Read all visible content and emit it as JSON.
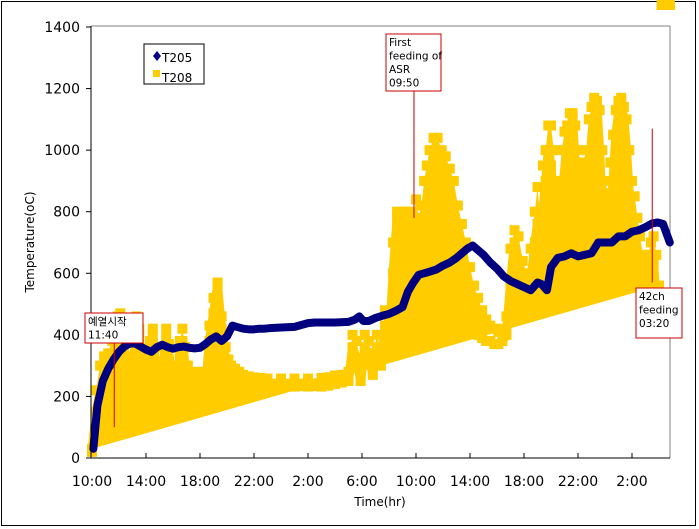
{
  "chart_data": {
    "type": "scatter",
    "title": "",
    "xlabel": "Time(hr)",
    "ylabel": "Temperature(oC)",
    "ylim": [
      0,
      1400
    ],
    "yticks": [
      0,
      200,
      400,
      600,
      800,
      1000,
      1200,
      1400
    ],
    "xlim_hours_from_start": [
      0,
      42.9
    ],
    "xticks": [
      {
        "h": 0,
        "label": "10:00"
      },
      {
        "h": 4,
        "label": "14:00"
      },
      {
        "h": 8,
        "label": "18:00"
      },
      {
        "h": 12,
        "label": "22:00"
      },
      {
        "h": 16,
        "label": "2:00"
      },
      {
        "h": 20,
        "label": "6:00"
      },
      {
        "h": 24,
        "label": "10:00"
      },
      {
        "h": 28,
        "label": "14:00"
      },
      {
        "h": 32,
        "label": "18:00"
      },
      {
        "h": 36,
        "label": "22:00"
      },
      {
        "h": 40,
        "label": "2:00"
      }
    ],
    "grid": false,
    "legend": {
      "position": "top-left",
      "entries": [
        {
          "name": "T205",
          "marker": "diamond",
          "color": "#00007F"
        },
        {
          "name": "T208",
          "marker": "square",
          "color": "#FFCC00"
        }
      ]
    },
    "series": [
      {
        "name": "T205",
        "color": "#00007F",
        "x_hours": [
          0.1,
          0.4,
          0.8,
          1.2,
          1.6,
          2.0,
          2.4,
          2.8,
          3.2,
          3.6,
          4.0,
          4.4,
          4.8,
          5.2,
          5.6,
          6.0,
          6.4,
          6.8,
          7.2,
          7.6,
          8.0,
          8.4,
          8.8,
          9.2,
          9.6,
          10.0,
          10.4,
          10.8,
          11.2,
          11.6,
          12.0,
          12.4,
          12.8,
          13.2,
          14.0,
          15.0,
          16.0,
          16.5,
          17.0,
          18.0,
          19.0,
          19.5,
          19.8,
          20.1,
          20.5,
          21.0,
          21.5,
          22.0,
          22.5,
          23.0,
          23.4,
          23.8,
          24.2,
          24.6,
          25.0,
          25.5,
          26.0,
          26.5,
          27.0,
          27.4,
          27.8,
          28.2,
          28.6,
          29.0,
          29.5,
          30.0,
          30.5,
          31.0,
          31.5,
          32.0,
          32.5,
          33.0,
          33.3,
          33.7,
          34.0,
          34.5,
          35.0,
          35.5,
          36.0,
          36.5,
          37.0,
          37.5,
          38.0,
          38.5,
          39.0,
          39.5,
          40.0,
          40.5,
          41.0,
          41.5,
          41.9,
          42.3,
          42.8
        ],
        "values": [
          30,
          170,
          250,
          290,
          320,
          345,
          362,
          372,
          372,
          362,
          352,
          345,
          360,
          368,
          360,
          355,
          360,
          362,
          358,
          356,
          358,
          370,
          385,
          395,
          380,
          395,
          430,
          425,
          420,
          418,
          418,
          420,
          420,
          422,
          424,
          426,
          438,
          440,
          440,
          440,
          442,
          450,
          460,
          445,
          445,
          455,
          462,
          468,
          478,
          490,
          540,
          570,
          595,
          600,
          605,
          612,
          625,
          635,
          650,
          665,
          680,
          690,
          675,
          660,
          635,
          615,
          590,
          575,
          565,
          555,
          545,
          570,
          565,
          545,
          620,
          650,
          655,
          665,
          655,
          660,
          665,
          700,
          700,
          700,
          720,
          720,
          735,
          740,
          750,
          762,
          765,
          760,
          700
        ]
      },
      {
        "name": "T208",
        "color": "#FFCC00",
        "x_hours": [
          0,
          0.3,
          0.6,
          0.9,
          1.2,
          1.5,
          1.7,
          1.9,
          2.1,
          2.3,
          2.5,
          2.7,
          2.9,
          3.1,
          3.3,
          3.5,
          3.7,
          3.9,
          4.1,
          4.3,
          4.5,
          4.7,
          4.9,
          5.1,
          5.3,
          5.5,
          5.7,
          5.9,
          6.1,
          6.3,
          6.5,
          6.7,
          6.9,
          7.1,
          7.3,
          7.5,
          7.8,
          8.1,
          8.4,
          8.7,
          9.0,
          9.3,
          9.6,
          9.9,
          10.1,
          10.3,
          10.6,
          10.9,
          11.2,
          11.6,
          12.0,
          12.5,
          13.0,
          14.0,
          15.0,
          16.0,
          17.0,
          17.5,
          18.0,
          18.5,
          19.0,
          19.3,
          19.6,
          19.9,
          20.2,
          20.5,
          20.8,
          21.1,
          21.4,
          21.7,
          22.0,
          22.3,
          22.6,
          22.9,
          23.2,
          23.5,
          23.8,
          24.0,
          24.2,
          24.4,
          24.6,
          24.8,
          25.0,
          25.3,
          25.6,
          25.9,
          26.2,
          26.5,
          26.8,
          27.1,
          27.4,
          27.7,
          28.0,
          28.3,
          28.6,
          28.9,
          29.2,
          29.5,
          29.8,
          30.1,
          30.4,
          30.7,
          31.0,
          31.3,
          31.6,
          31.9,
          32.2,
          32.5,
          32.8,
          33.0,
          33.2,
          33.4,
          33.6,
          33.8,
          34.0,
          34.2,
          34.4,
          34.6,
          34.8,
          35.0,
          35.2,
          35.4,
          35.6,
          35.8,
          36.0,
          36.2,
          36.4,
          36.6,
          36.8,
          37.0,
          37.2,
          37.4,
          37.6,
          37.8,
          38.0,
          38.2,
          38.4,
          38.6,
          38.8,
          39.0,
          39.2,
          39.4,
          39.6,
          39.8,
          40.0,
          40.2,
          40.4,
          40.6,
          40.8,
          41.0,
          41.2,
          41.4,
          41.6,
          41.8,
          42.0,
          42.2,
          42.4,
          42.6,
          42.8
        ],
        "values": [
          20,
          150,
          220,
          250,
          270,
          300,
          360,
          430,
          440,
          400,
          300,
          250,
          230,
          330,
          430,
          400,
          290,
          240,
          230,
          320,
          400,
          310,
          250,
          230,
          310,
          390,
          320,
          250,
          230,
          230,
          330,
          380,
          300,
          240,
          225,
          220,
          230,
          225,
          230,
          380,
          470,
          560,
          420,
          320,
          280,
          265,
          255,
          250,
          245,
          240,
          238,
          236,
          234,
          232,
          232,
          232,
          232,
          235,
          240,
          245,
          250,
          360,
          320,
          250,
          360,
          340,
          270,
          360,
          300,
          430,
          360,
          600,
          780,
          650,
          800,
          700,
          750,
          780,
          700,
          760,
          750,
          800,
          850,
          960,
          1000,
          820,
          900,
          850,
          780,
          700,
          640,
          550,
          480,
          420,
          400,
          390,
          380,
          380,
          370,
          370,
          380,
          400,
          570,
          700,
          640,
          520,
          480,
          560,
          700,
          760,
          620,
          800,
          900,
          1000,
          950,
          800,
          700,
          650,
          760,
          850,
          900,
          1050,
          1100,
          950,
          800,
          700,
          650,
          760,
          900,
          1000,
          1080,
          1150,
          1000,
          800,
          700,
          600,
          760,
          900,
          1050,
          1120,
          1160,
          1100,
          1000,
          850,
          750,
          700,
          640,
          600,
          560,
          540,
          560,
          600,
          630,
          520,
          480
        ],
        "upper": [
          30,
          220,
          300,
          330,
          340,
          380,
          380,
          460,
          470,
          440,
          400,
          330,
          300,
          380,
          460,
          420,
          350,
          300,
          280,
          380,
          420,
          360,
          300,
          280,
          360,
          420,
          370,
          300,
          280,
          280,
          380,
          420,
          360,
          300,
          275,
          270,
          280,
          270,
          280,
          430,
          520,
          570,
          460,
          360,
          320,
          300,
          290,
          280,
          270,
          265,
          262,
          260,
          258,
          258,
          258,
          258,
          260,
          262,
          268,
          270,
          280,
          400,
          380,
          300,
          400,
          380,
          320,
          400,
          350,
          480,
          420,
          700,
          800,
          760,
          800,
          800,
          780,
          840,
          780,
          820,
          900,
          950,
          1000,
          1040,
          1040,
          1000,
          980,
          940,
          900,
          820,
          760,
          700,
          620,
          560,
          520,
          480,
          450,
          430,
          420,
          410,
          420,
          460,
          680,
          740,
          720,
          640,
          600,
          680,
          800,
          880,
          780,
          950,
          1000,
          1080,
          1080,
          1000,
          900,
          900,
          1000,
          1060,
          1080,
          1120,
          1120,
          1080,
          1000,
          940,
          960,
          1000,
          1100,
          1140,
          1170,
          1160,
          1130,
          1000,
          900,
          860,
          960,
          1050,
          1130,
          1160,
          1170,
          1140,
          1100,
          1000,
          900,
          850,
          780,
          720,
          660,
          640,
          660,
          700,
          720,
          660,
          560
        ]
      }
    ],
    "annotations": [
      {
        "id": "preheat",
        "lines": [
          "예열시작",
          "11:40"
        ],
        "x_hours": 1.65,
        "line_from": 430,
        "line_to": 100
      },
      {
        "id": "first-feed",
        "lines": [
          "First",
          "feeding of",
          "ASR",
          "09:50"
        ],
        "x_hours": 23.85,
        "line_from": 1220,
        "line_to": 780
      },
      {
        "id": "ch42-feed",
        "lines": [
          "42ch",
          "feeding",
          "03:20"
        ],
        "x_hours": 41.5,
        "line_from": 1070,
        "line_to": 570
      }
    ]
  }
}
